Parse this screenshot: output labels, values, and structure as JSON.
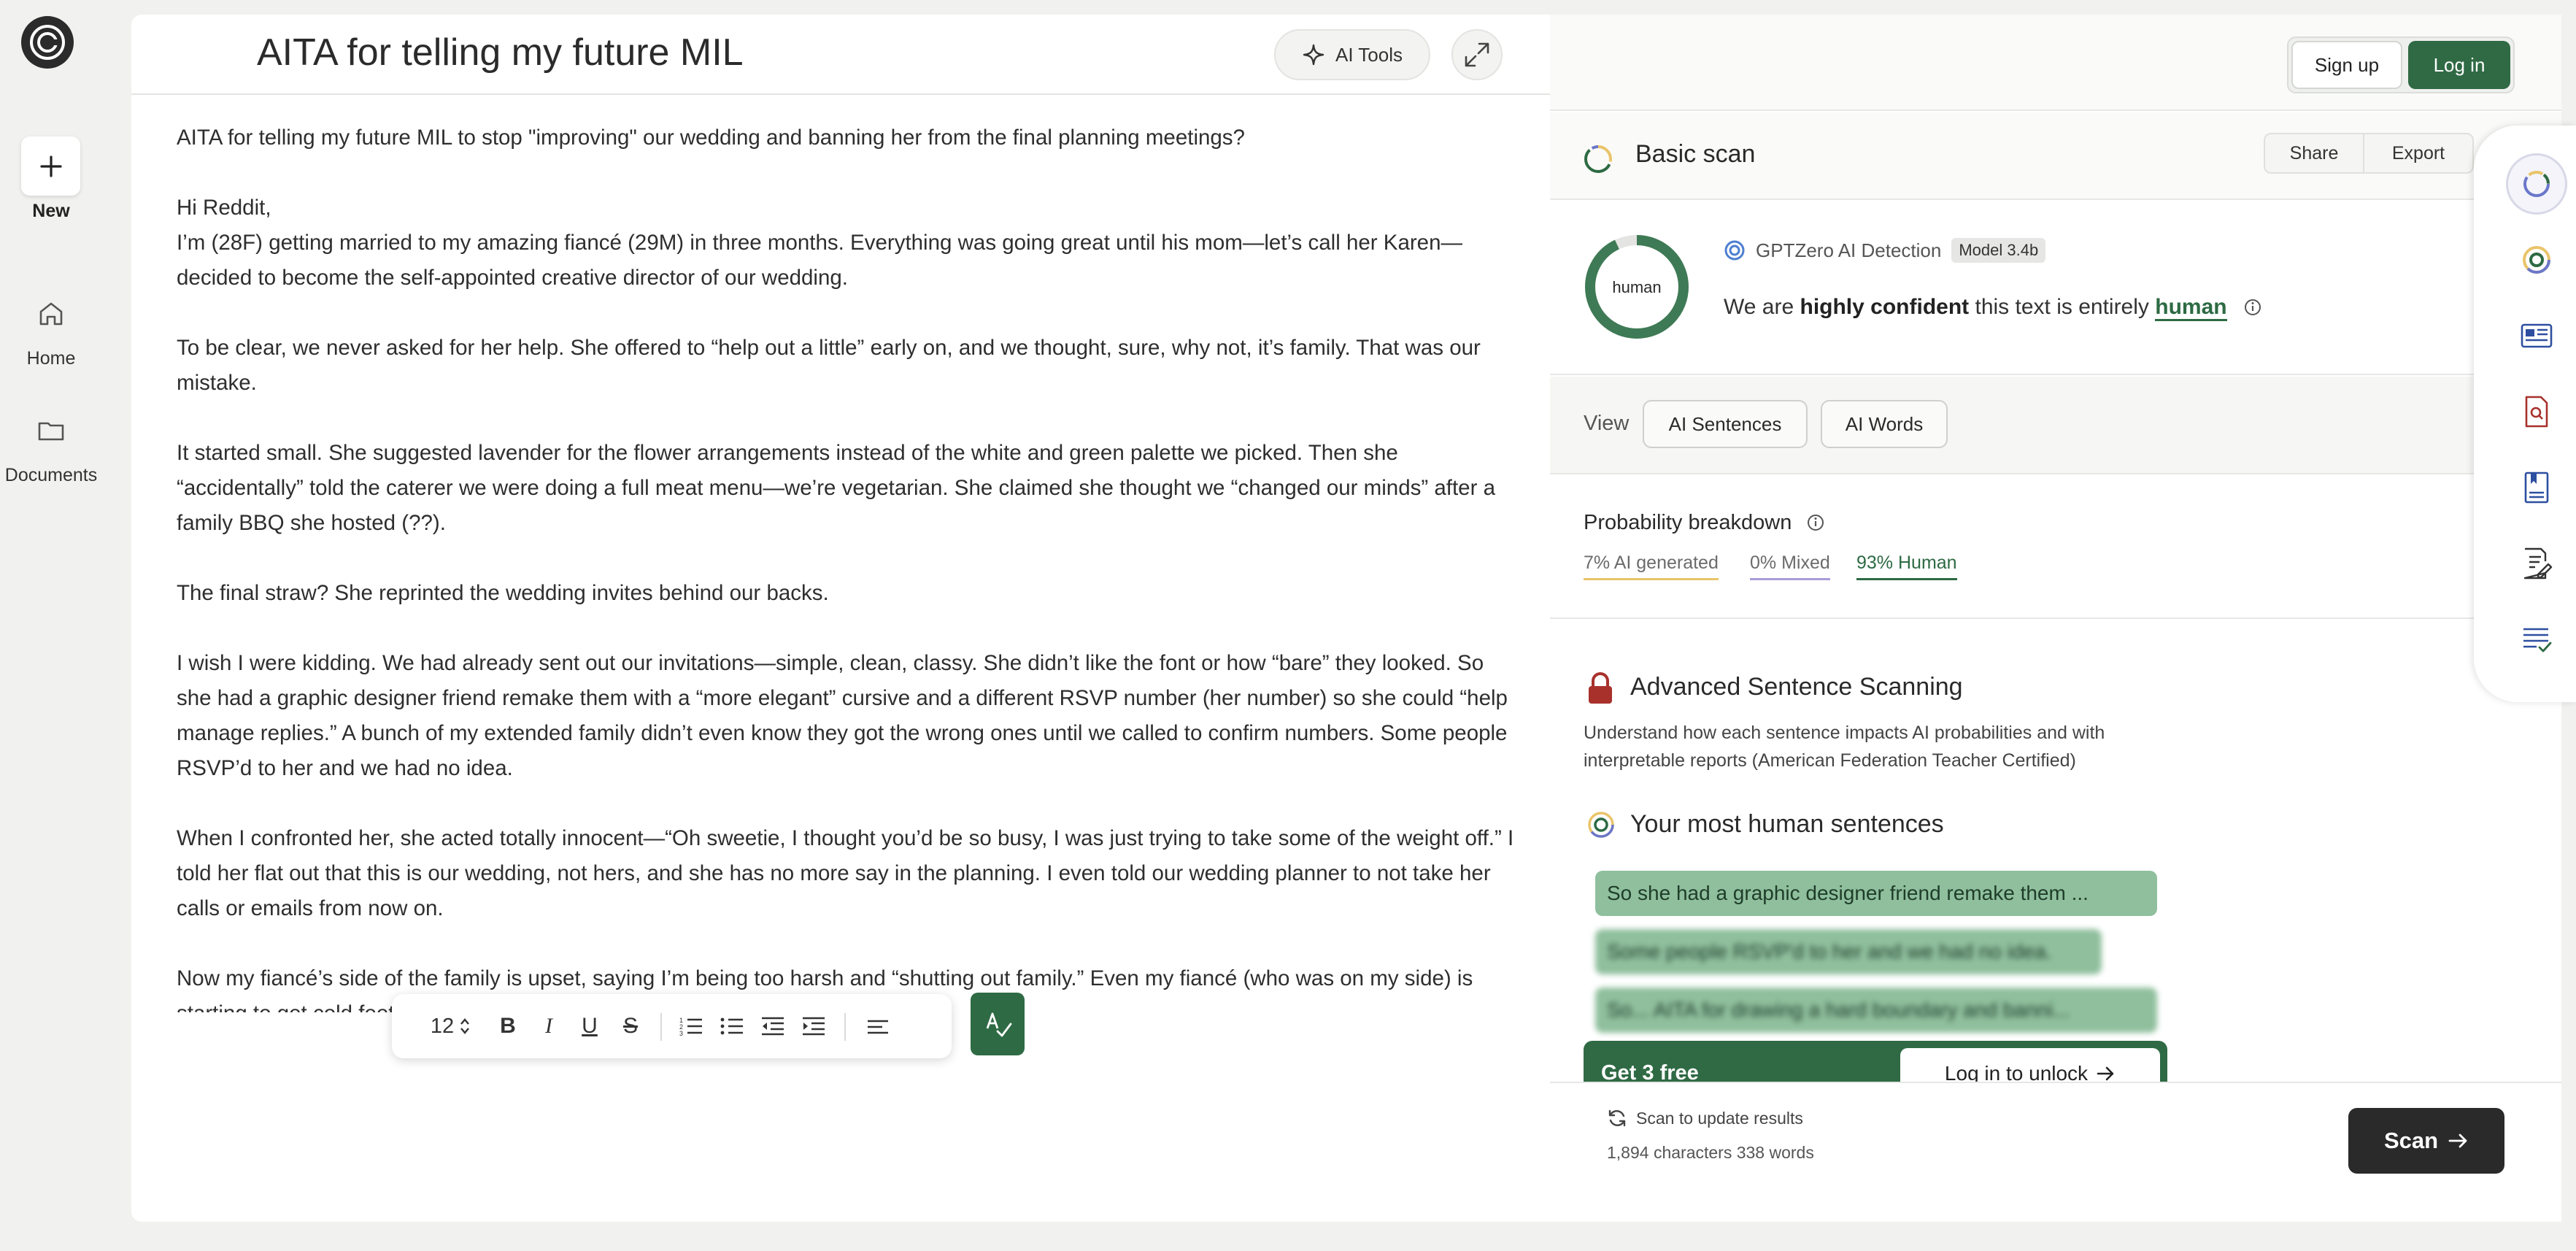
{
  "rail": {
    "new_label": "New",
    "home_label": "Home",
    "documents_label": "Documents"
  },
  "editor": {
    "title": "AITA for telling my future MIL",
    "ai_tools_label": "AI Tools",
    "paragraphs": [
      "AITA for telling my future MIL to stop \"improving\" our wedding and banning her from the final planning meetings?",
      "Hi Reddit,\nI’m (28F) getting married to my amazing fiancé (29M) in three months. Everything was going great until his mom—let’s call her Karen—decided to become the self-appointed creative director of our wedding.",
      "To be clear, we never asked for her help. She offered to “help out a little” early on, and we thought, sure, why not, it’s family. That was our mistake.",
      "It started small. She suggested lavender for the flower arrangements instead of the white and green palette we picked. Then she “accidentally” told the caterer we were doing a full meat menu—we’re vegetarian. She claimed she thought we “changed our minds” after a family BBQ she hosted (??).",
      "The final straw? She reprinted the wedding invites behind our backs.",
      "I wish I were kidding. We had already sent out our invitations—simple, clean, classy. She didn’t like the font or how “bare” they looked. So she had a graphic designer friend remake them with a “more elegant” cursive and a different RSVP number (her number) so she could “help manage replies.” A bunch of my extended family didn’t even know they got the wrong ones until we called to confirm numbers. Some people RSVP’d to her and we had no idea.",
      "When I confronted her, she acted totally innocent—“Oh sweetie, I thought you’d be so busy, I was just trying to take some of the weight off.” I told her flat out that this is our wedding, not hers, and she has no more say in the planning. I even told our wedding planner to not take her calls or emails from now on.",
      "Now my fiancé’s side of the family is upset, saying I’m being too harsh and “shutting out family.” Even my fiancé (who was on my side) is starting to get cold feet about “banning his mom from helping.”"
    ],
    "toolbar": {
      "font_size": "12",
      "bold": "B",
      "italic": "I",
      "underline": "U",
      "strike": "S"
    }
  },
  "panel": {
    "signup_label": "Sign up",
    "login_label": "Log in",
    "scan_title": "Basic scan",
    "share_label": "Share",
    "export_label": "Export",
    "donut_label": "human",
    "donut_human_fraction": 0.93,
    "detector_name": "GPTZero AI Detection",
    "model_badge": "Model 3.4b",
    "verdict": {
      "pre": "We are ",
      "strong": "highly confident",
      "mid": " this text is entirely ",
      "result": "human"
    },
    "view_label": "View",
    "view_ai_sentences": "AI Sentences",
    "view_ai_words": "AI Words",
    "prob_title": "Probability breakdown",
    "prob": {
      "ai": "7% AI generated",
      "mixed": "0% Mixed",
      "human": "93% Human"
    },
    "adv_title": "Advanced Sentence Scanning",
    "adv_desc": "Understand how each sentence impacts AI probabilities and with interpretable reports (American Federation Teacher Certified)",
    "human_title": "Your most human sentences",
    "sentences": [
      "So she had a graphic designer friend remake them ...",
      "Some people RSVP'd to her and we had no idea.",
      "So... AITA for drawing a hard boundary and banni..."
    ],
    "unlock_text": "Get 3 free",
    "unlock_button": "Log in to unlock",
    "scan_note": "Scan to update results",
    "counts": "1,894 characters 338 words",
    "scan_button": "Scan"
  },
  "colors": {
    "brand_green": "#2f6a44",
    "ai_yellow": "#e9c46a",
    "mixed_purple": "#a99bd8",
    "human_green": "#2d6a43"
  }
}
